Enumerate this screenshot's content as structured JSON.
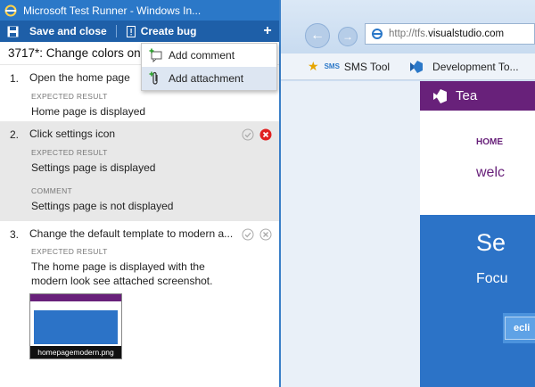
{
  "runner": {
    "title": "Microsoft Test Runner - Windows In...",
    "toolbar": {
      "save_close": "Save and close",
      "create_bug": "Create bug",
      "add": "+"
    },
    "testcase_title": "3717*: Change colors on",
    "steps": [
      {
        "num": "1.",
        "text": "Open the home page",
        "expected_label": "EXPECTED RESULT",
        "expected": "Home page is displayed"
      },
      {
        "num": "2.",
        "text": "Click settings icon",
        "expected_label": "EXPECTED RESULT",
        "expected": "Settings page is displayed",
        "comment_label": "COMMENT",
        "comment": "Settings page is not displayed"
      },
      {
        "num": "3.",
        "text": "Change the default template to modern a...",
        "expected_label": "EXPECTED RESULT",
        "expected": "The home page is displayed with the modern look see attached screenshot.",
        "attachment": "homepagemodern.png"
      }
    ]
  },
  "menu": {
    "items": [
      "Add comment",
      "Add attachment"
    ],
    "highlighted_index": 1
  },
  "browser": {
    "back": "←",
    "forward": "→",
    "url_prefix": "http://tfs.",
    "url_host": "visualstudio.com",
    "favorites": [
      {
        "badge": "SMS",
        "label": "SMS Tool"
      },
      {
        "label": "Development To..."
      }
    ],
    "site": {
      "header": "Tea",
      "nav_home": "HOME",
      "welcome": "welc",
      "hero_title": "Se",
      "hero_sub": "Focu",
      "hero_button": "ecli"
    }
  },
  "colors": {
    "titlebar": "#2b78c8",
    "toolbar": "#1e5fa8",
    "vs_purple": "#68217a",
    "hero_blue": "#2c73c7",
    "fail_red": "#e02020"
  }
}
